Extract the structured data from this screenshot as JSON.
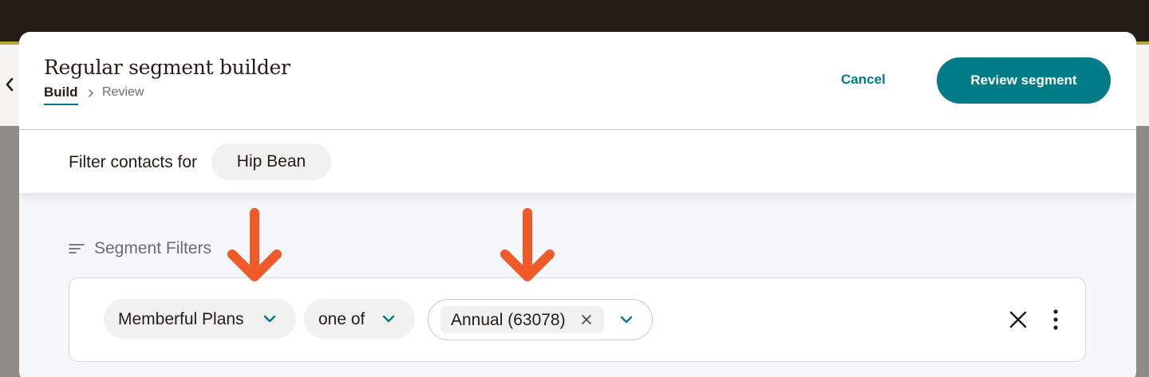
{
  "modal": {
    "title": "Regular segment builder",
    "breadcrumb": {
      "build": "Build",
      "review": "Review"
    },
    "cancel_label": "Cancel",
    "review_button_label": "Review segment"
  },
  "filter_bar": {
    "label": "Filter contacts for",
    "audience": "Hip Bean"
  },
  "segment_filters": {
    "heading": "Segment Filters",
    "rows": [
      {
        "field": "Memberful Plans",
        "operator": "one of",
        "values": [
          "Annual (63078)"
        ]
      }
    ]
  },
  "icons": {
    "back": "chevron-left-icon",
    "breadcrumb_separator": "chevron-right-icon",
    "segment_filters": "filter-lines-icon",
    "dropdown": "chevron-down-icon",
    "tag_remove": "close-icon",
    "row_remove": "close-icon",
    "row_menu": "more-vertical-icon",
    "annotation": "arrow-down-icon"
  },
  "colors": {
    "accent": "#007c89",
    "topbar": "#241c15",
    "annotation_arrow": "#f05a28",
    "text": "#241c15",
    "muted_text": "#6e6c6a"
  }
}
